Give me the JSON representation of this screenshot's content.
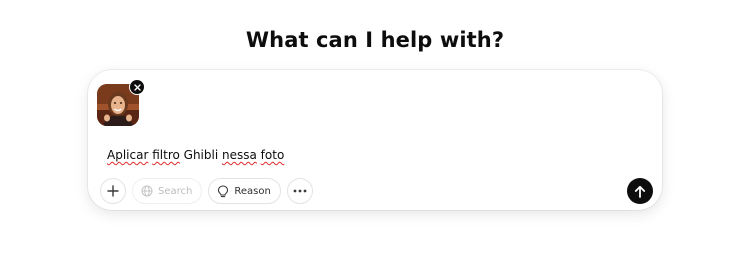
{
  "heading": "What can I help with?",
  "composer": {
    "attachment": {
      "kind": "image",
      "icon": "remove-icon"
    },
    "prompt_text": {
      "segments": [
        {
          "text": "Aplicar",
          "spellcheck_error": true
        },
        {
          "text": " ",
          "spellcheck_error": false
        },
        {
          "text": "filtro",
          "spellcheck_error": true
        },
        {
          "text": " Ghibli ",
          "spellcheck_error": false
        },
        {
          "text": "nessa",
          "spellcheck_error": true
        },
        {
          "text": " ",
          "spellcheck_error": false
        },
        {
          "text": "foto",
          "spellcheck_error": true
        }
      ]
    },
    "toolbar": {
      "add_icon": "plus-icon",
      "search": {
        "label": "Search",
        "icon": "globe-icon",
        "state": "disabled"
      },
      "reason": {
        "label": "Reason",
        "icon": "lightbulb-icon",
        "state": "enabled"
      },
      "more_icon": "ellipsis-icon",
      "send_icon": "arrow-up-icon"
    }
  },
  "colors": {
    "text": "#0d0d0d",
    "send_button": "#0d0d0d",
    "disabled_text": "#bdbdbd",
    "border": "#e3e3e3",
    "spellcheck_underline": "#e02b2b"
  }
}
